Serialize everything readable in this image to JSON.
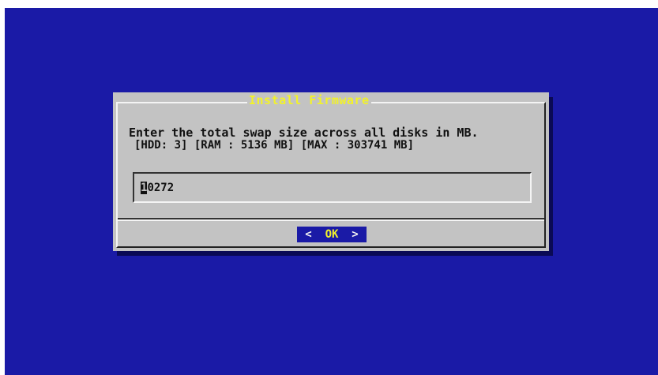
{
  "screen": {
    "background_color": "#1a1aa6"
  },
  "dialog": {
    "title": "Install Firmware",
    "prompt_line1": "Enter the total swap size across all disks in MB.",
    "prompt_line2": "[HDD: 3] [RAM : 5136 MB] [MAX : 303741 MB]",
    "input": {
      "value_cursor_char": "1",
      "value_rest": "0272",
      "full_value": "10272"
    },
    "ok_button": {
      "left_bracket": "<",
      "label": "OK",
      "right_bracket": ">"
    },
    "colors": {
      "body": "#c3c3c3",
      "title_text": "#f2f22a",
      "button_bg": "#1a1aa6"
    }
  }
}
